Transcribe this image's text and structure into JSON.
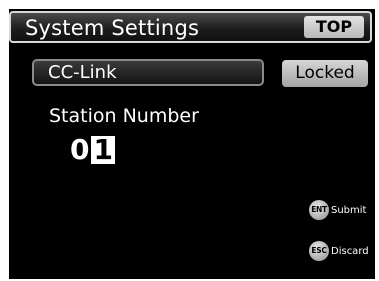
{
  "header": {
    "title": "System Settings",
    "top_button": "TOP"
  },
  "network": {
    "mode": "CC-Link",
    "lock_button": "Locked"
  },
  "station": {
    "label": "Station Number",
    "digits": [
      "0",
      "1"
    ],
    "cursor_digit_index": 1
  },
  "key_hints": [
    {
      "key": "ENT",
      "label": "Submit"
    },
    {
      "key": "ESC",
      "label": "Discard"
    }
  ],
  "colors": {
    "screen_background": "#000000",
    "text": "#ffffff",
    "button_face": "#c8c8c8",
    "cursor_highlight": "#ffffff"
  }
}
